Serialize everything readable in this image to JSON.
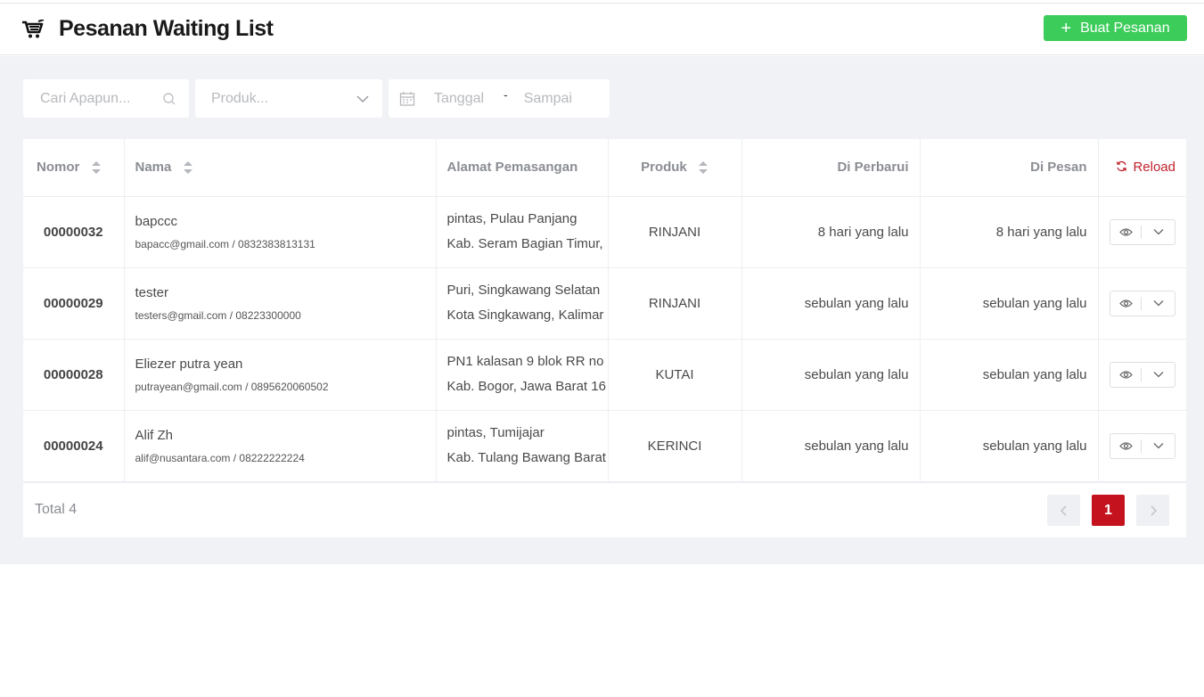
{
  "header": {
    "title": "Pesanan Waiting List",
    "create_button": "Buat Pesanan"
  },
  "filters": {
    "search_placeholder": "Cari Apapun...",
    "product_placeholder": "Produk...",
    "date_start_placeholder": "Tanggal",
    "date_separator": "-",
    "date_end_placeholder": "Sampai"
  },
  "table": {
    "columns": {
      "nomor": "Nomor",
      "nama": "Nama",
      "alamat": "Alamat Pemasangan",
      "produk": "Produk",
      "diperbarui": "Di Perbarui",
      "dipesan": "Di Pesan",
      "reload": "Reload"
    },
    "rows": [
      {
        "nomor": "00000032",
        "nama": "bapccc",
        "kontak": "bapacc@gmail.com / 0832383813131",
        "alamat1": "pintas, Pulau Panjang",
        "alamat2": "Kab. Seram Bagian Timur,",
        "produk": "RINJANI",
        "diperbarui": "8 hari yang lalu",
        "dipesan": "8 hari yang lalu"
      },
      {
        "nomor": "00000029",
        "nama": "tester",
        "kontak": "testers@gmail.com / 08223300000",
        "alamat1": "Puri, Singkawang Selatan",
        "alamat2": "Kota Singkawang, Kalimar",
        "produk": "RINJANI",
        "diperbarui": "sebulan yang lalu",
        "dipesan": "sebulan yang lalu"
      },
      {
        "nomor": "00000028",
        "nama": "Eliezer putra yean",
        "kontak": "putrayean@gmail.com / 0895620060502",
        "alamat1": "PN1 kalasan 9 blok RR no",
        "alamat2": "Kab. Bogor, Jawa Barat 16",
        "produk": "KUTAI",
        "diperbarui": "sebulan yang lalu",
        "dipesan": "sebulan yang lalu"
      },
      {
        "nomor": "00000024",
        "nama": "Alif Zh",
        "kontak": "alif@nusantara.com / 08222222224",
        "alamat1": "pintas, Tumijajar",
        "alamat2": "Kab. Tulang Bawang Barat",
        "produk": "KERINCI",
        "diperbarui": "sebulan yang lalu",
        "dipesan": "sebulan yang lalu"
      }
    ]
  },
  "footer": {
    "total": "Total 4",
    "current_page": "1"
  },
  "icons": {
    "cart": "cart-icon",
    "plus": "plus-icon",
    "search": "search-icon",
    "chevron": "chevron-down-icon",
    "calendar": "calendar-icon",
    "sort": "sort-icon",
    "reload": "reload-icon",
    "eye": "eye-icon",
    "prev": "chevron-left-icon",
    "next": "chevron-right-icon"
  },
  "colors": {
    "primary_green": "#3ccc5a",
    "accent_red": "#c4121f",
    "background": "#f0f2f5"
  }
}
